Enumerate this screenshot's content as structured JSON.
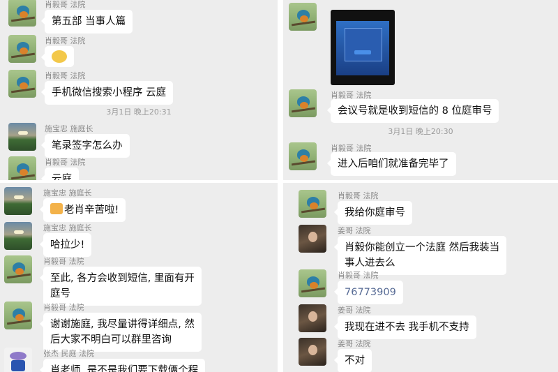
{
  "panel1": {
    "messages": [
      {
        "name": "肖毅哥 法院",
        "text": "第五部 当事人篇"
      },
      {
        "name": "肖毅哥 法院",
        "text": ""
      },
      {
        "name": "肖毅哥 法院",
        "text": "手机微信搜索小程序  云庭"
      },
      {
        "name": "施宝忠 施庭长",
        "text": "笔录签字怎么办"
      },
      {
        "name": "肖毅哥 法院",
        "text": "云庭"
      }
    ],
    "time": "3月1日 晚上20:31"
  },
  "panel2": {
    "messages": [
      {
        "name": "肖毅哥 法院",
        "text": "会议号就是收到短信的 8 位庭审号"
      },
      {
        "name": "肖毅哥 法院",
        "text": "进入后咱们就准备完毕了"
      }
    ],
    "time": "3月1日 晚上20:30"
  },
  "panel3": {
    "messages": [
      {
        "name": "施宝忠 施庭长",
        "text": "老肖辛苦啦!"
      },
      {
        "name": "施宝忠 施庭长",
        "text": "哈拉少!"
      },
      {
        "name": "肖毅哥 法院",
        "text": "至此, 各方会收到短信, 里面有开\n庭号"
      },
      {
        "name": "肖毅哥 法院",
        "text": "谢谢施庭, 我尽量讲得详细点, 然\n后大家不明白可以群里咨询"
      },
      {
        "name": "张杰 民庭 法院",
        "text": "肖老师, 是不是我们要下载俩个程"
      }
    ]
  },
  "panel4": {
    "messages": [
      {
        "name": "肖毅哥 法院",
        "text": "我给你庭审号"
      },
      {
        "name": "姜哥 法院",
        "text": "肖毅你能创立一个法庭 然后我装当\n事人进去么"
      },
      {
        "name": "肖毅哥 法院",
        "text": "76773909"
      },
      {
        "name": "姜哥 法院",
        "text": "我现在进不去 我手机不支持"
      },
      {
        "name": "姜哥 法院",
        "text": "不对"
      }
    ]
  },
  "icons": {
    "kingfisher_avatar": "kingfisher-avatar-icon",
    "landscape_avatar": "landscape-avatar-icon",
    "person_avatar": "person-avatar-icon",
    "flower_avatar": "flower-avatar-icon",
    "thumbs_up": "thumbs-up-icon",
    "laugh_emoji": "laugh-emoji-icon"
  },
  "colors": {
    "chat_bg": "#ededed",
    "bubble": "#ffffff",
    "link": "#576b95"
  }
}
